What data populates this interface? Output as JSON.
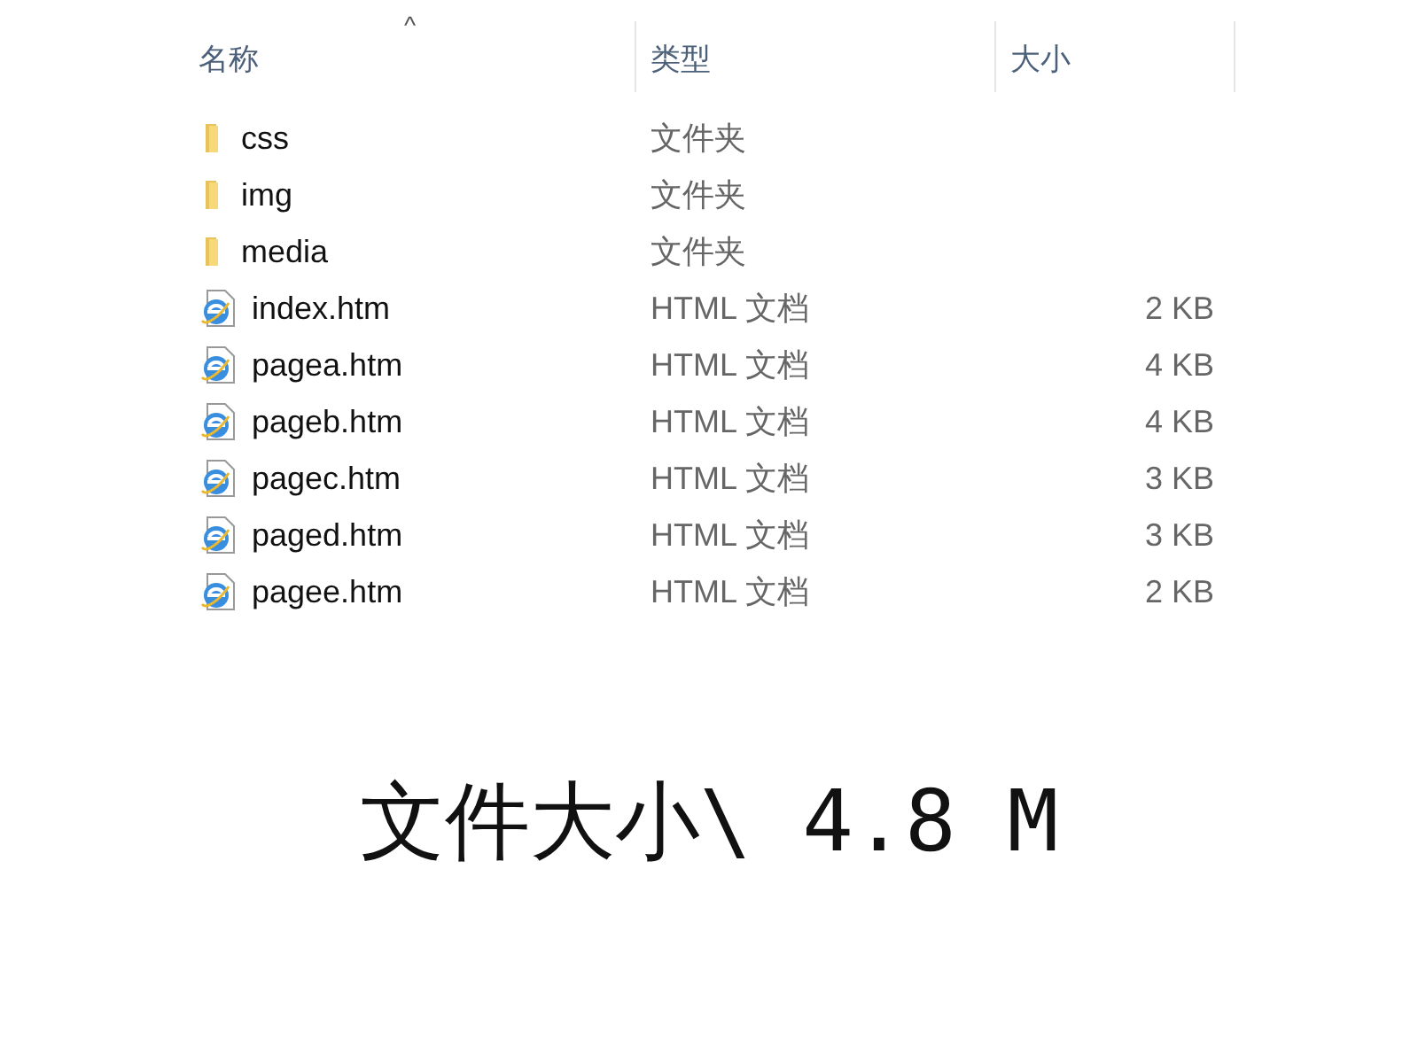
{
  "columns": [
    {
      "label": "名称",
      "sorted": true
    },
    {
      "label": "类型",
      "sorted": false
    },
    {
      "label": "大小",
      "sorted": false
    }
  ],
  "sort_indicator": "^",
  "files": [
    {
      "kind": "folder",
      "name": "css",
      "type": "文件夹"
    },
    {
      "kind": "folder",
      "name": "img",
      "type": "文件夹"
    },
    {
      "kind": "folder",
      "name": "media",
      "type": "文件夹"
    },
    {
      "kind": "html",
      "name": "index.htm",
      "type": "HTML 文档",
      "size": "2 KB"
    },
    {
      "kind": "html",
      "name": "pagea.htm",
      "type": "HTML 文档",
      "size": "4 KB"
    },
    {
      "kind": "html",
      "name": "pageb.htm",
      "type": "HTML 文档",
      "size": "4 KB"
    },
    {
      "kind": "html",
      "name": "pagec.htm",
      "type": "HTML 文档",
      "size": "3 KB"
    },
    {
      "kind": "html",
      "name": "paged.htm",
      "type": "HTML 文档",
      "size": "3 KB"
    },
    {
      "kind": "html",
      "name": "pagee.htm",
      "type": "HTML 文档",
      "size": "2 KB"
    }
  ],
  "caption": "文件大小\\ 4.8 M"
}
